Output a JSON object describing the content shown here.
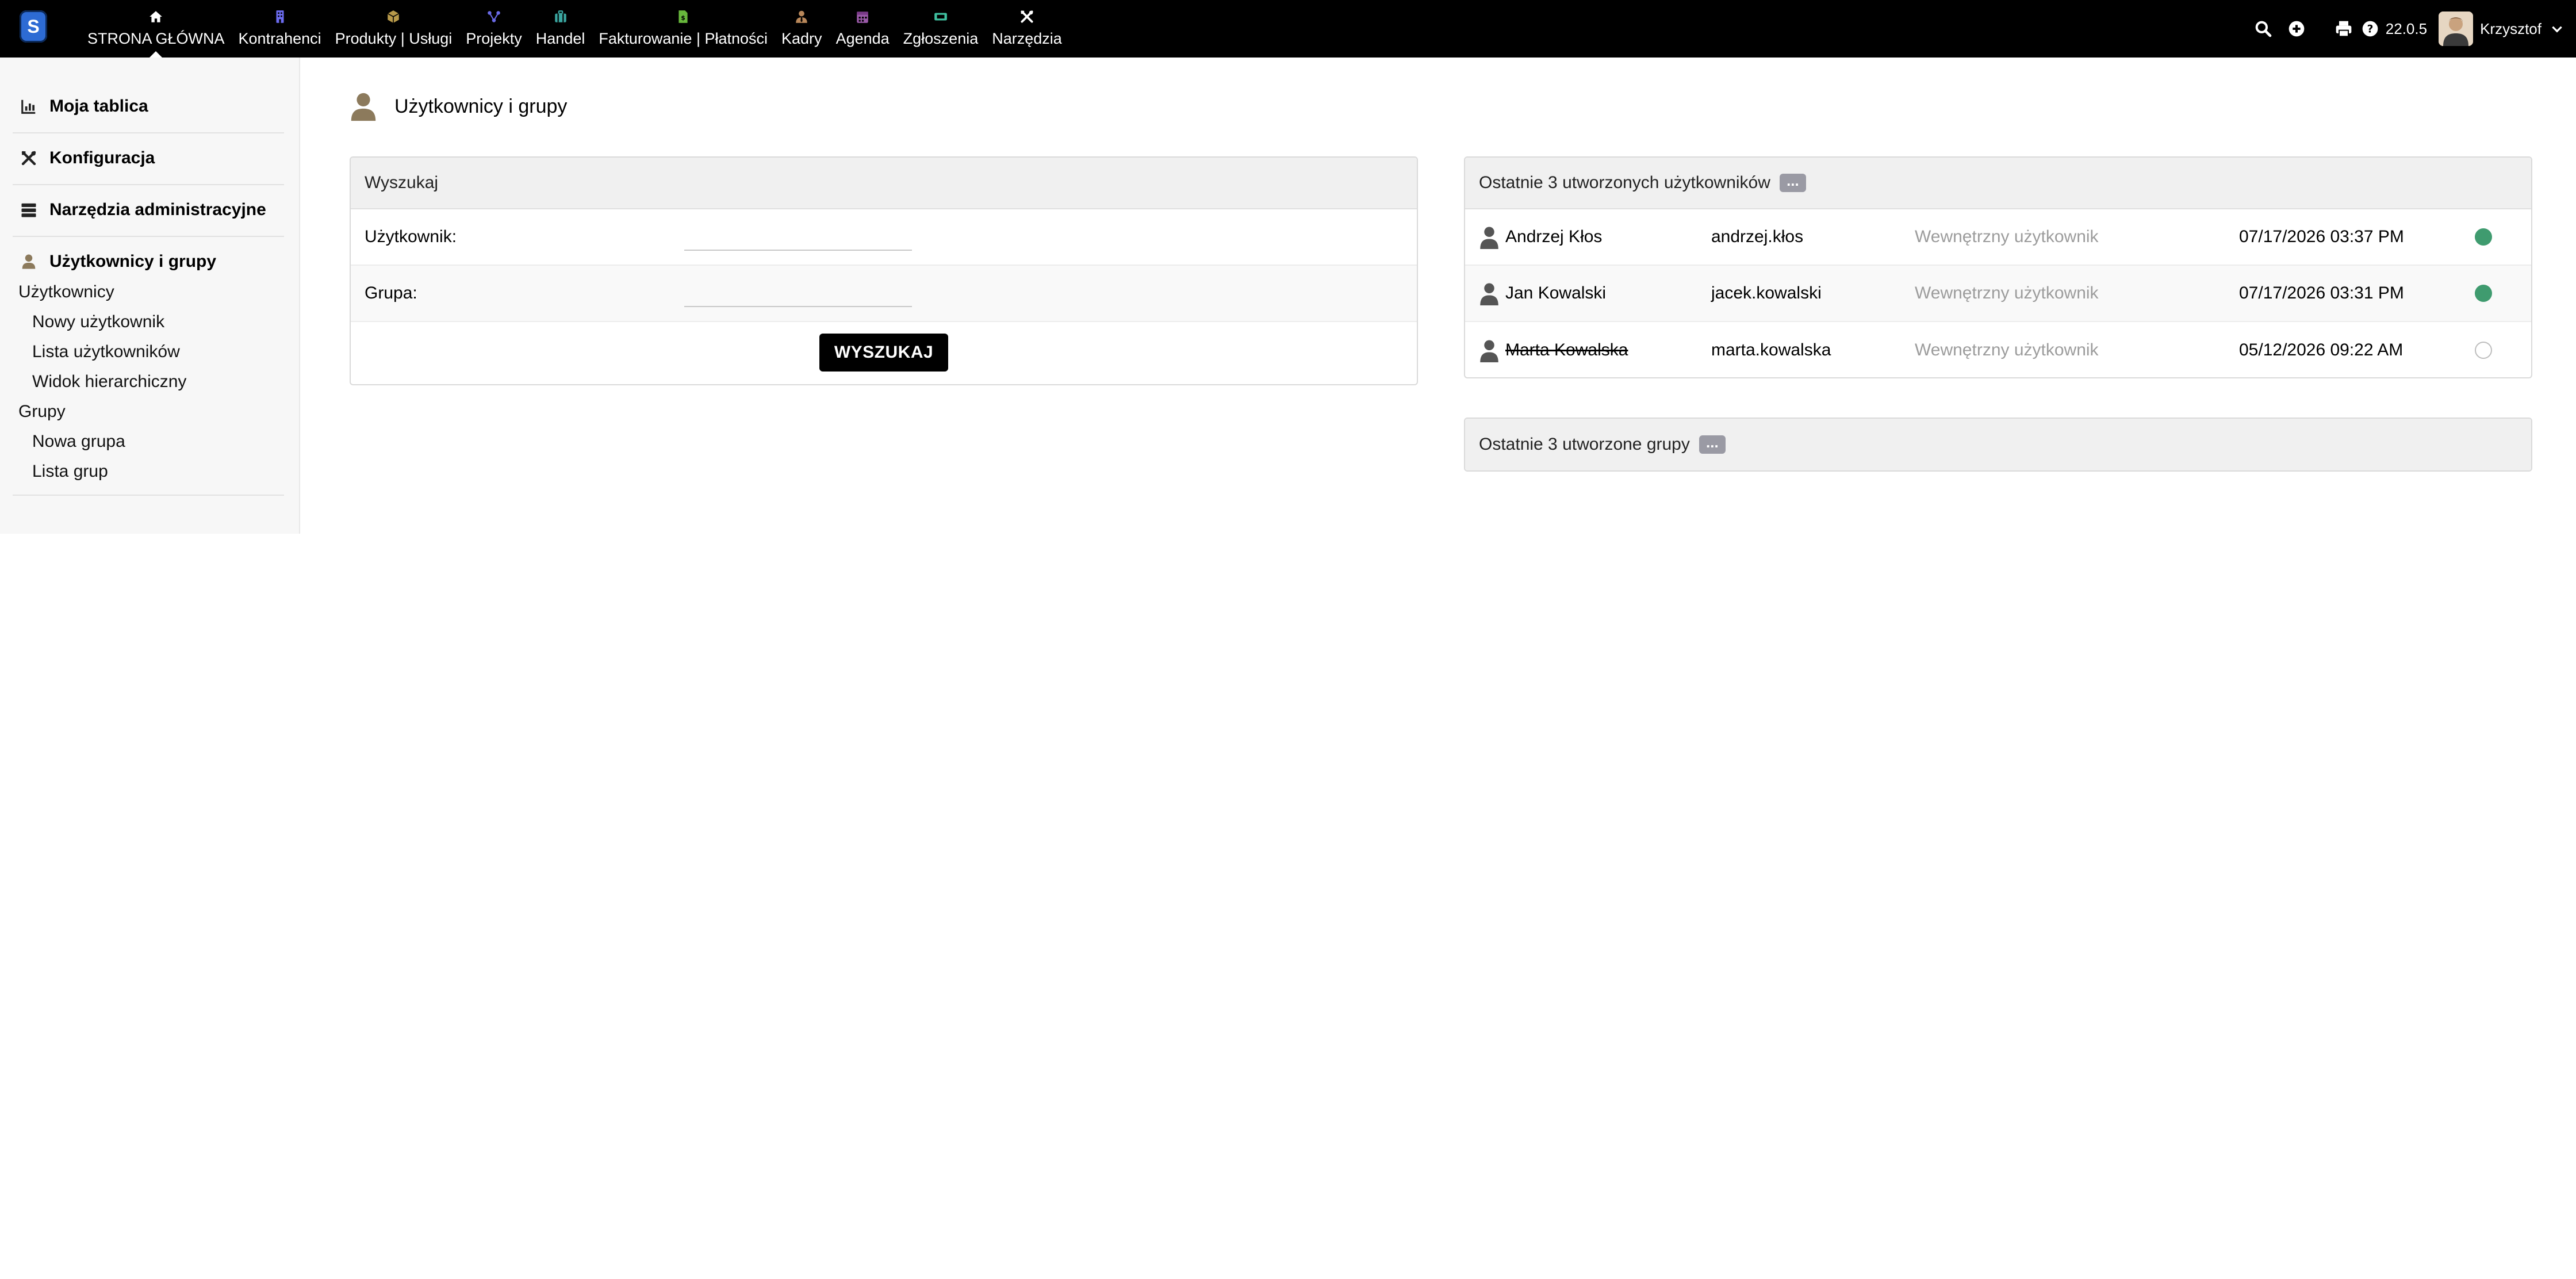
{
  "app": {
    "logo_letter": "S",
    "version": "22.0.5",
    "user": {
      "name": "Krzysztof"
    }
  },
  "topnav": [
    {
      "label": "STRONA GŁÓWNA",
      "icon": "home-icon",
      "color": "#ffffff"
    },
    {
      "label": "Kontrahenci",
      "icon": "building-icon",
      "color": "#6c6cf0"
    },
    {
      "label": "Produkty | Usługi",
      "icon": "cube-icon",
      "color": "#b89a4a"
    },
    {
      "label": "Projekty",
      "icon": "sitemap-icon",
      "color": "#6a6ae6"
    },
    {
      "label": "Handel",
      "icon": "suitcase-icon",
      "color": "#3aa6a0"
    },
    {
      "label": "Fakturowanie | Płatności",
      "icon": "invoice-icon",
      "color": "#68b83c"
    },
    {
      "label": "Kadry",
      "icon": "person-tie-icon",
      "color": "#b8875a"
    },
    {
      "label": "Agenda",
      "icon": "calendar-icon",
      "color": "#9a5aa8"
    },
    {
      "label": "Zgłoszenia",
      "icon": "ticket-icon",
      "color": "#3fc0a0"
    },
    {
      "label": "Narzędzia",
      "icon": "tools-icon",
      "color": "#ffffff"
    }
  ],
  "sidebar": {
    "dashboard": "Moja tablica",
    "config": "Konfiguracja",
    "admin_tools": "Narzędzia administracyjne",
    "users_groups": "Użytkownicy i grupy",
    "users": "Użytkownicy",
    "new_user": "Nowy użytkownik",
    "user_list": "Lista użytkowników",
    "hierarchy": "Widok hierarchiczny",
    "groups": "Grupy",
    "new_group": "Nowa grupa",
    "group_list": "Lista grup"
  },
  "page": {
    "title": "Użytkownicy i grupy"
  },
  "search": {
    "title": "Wyszukaj",
    "user_label": "Użytkownik:",
    "user_value": "",
    "group_label": "Grupa:",
    "group_value": "",
    "button": "WYSZUKAJ"
  },
  "recent_users": {
    "title": "Ostatnie 3 utworzonych użytkowników",
    "more": "...",
    "rows": [
      {
        "name": "Andrzej Kłos",
        "login": "andrzej.kłos",
        "type": "Wewnętrzny użytkownik",
        "date": "07/17/2026 03:37 PM",
        "active": true
      },
      {
        "name": "Jan Kowalski",
        "login": "jacek.kowalski",
        "type": "Wewnętrzny użytkownik",
        "date": "07/17/2026 03:31 PM",
        "active": true
      },
      {
        "name": "Marta Kowalska",
        "login": "marta.kowalska",
        "type": "Wewnętrzny użytkownik",
        "date": "05/12/2026 09:22 AM",
        "active": false
      }
    ]
  },
  "recent_groups": {
    "title": "Ostatnie 3 utworzone grupy",
    "more": "..."
  },
  "colors": {
    "status_active": "#3f9b6f",
    "topbar": "#000000",
    "brand": "#2d6bd4"
  }
}
